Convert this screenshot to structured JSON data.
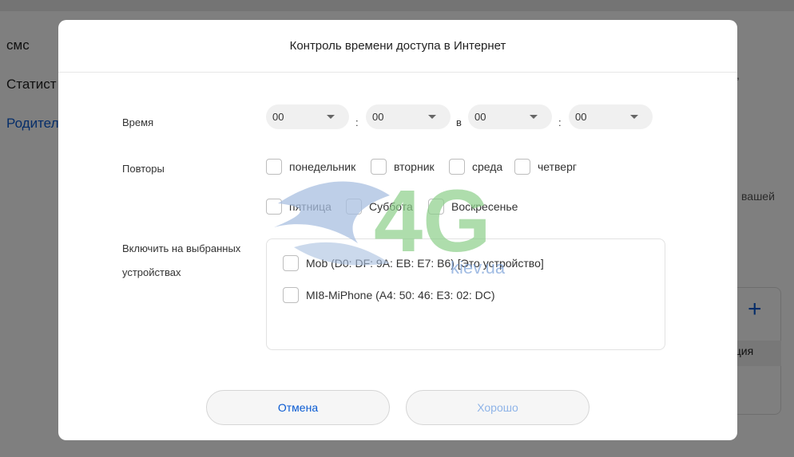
{
  "background": {
    "menu": [
      "смс",
      "Статист",
      "Родител"
    ],
    "right_texts": [
      ",",
      "вашей"
    ],
    "card_label": "ация"
  },
  "modal": {
    "title": "Контроль времени доступа в Интернет",
    "time": {
      "label": "Время",
      "start_hour": "00",
      "start_minute": "00",
      "separator": ":",
      "to_word": "в",
      "end_hour": "00",
      "end_minute": "00"
    },
    "repeat": {
      "label": "Повторы",
      "days": [
        "понедельник",
        "вторник",
        "среда",
        "четверг",
        "пятница",
        "Суббота",
        "Воскресенье"
      ]
    },
    "devices": {
      "label_line1": "Включить на выбранных",
      "label_line2": "устройствах",
      "items": [
        "Mob (D0: DF: 9A: EB: E7: B6) [Это устройство]",
        "MI8-MiPhone (A4: 50: 46: E3: 02: DC)"
      ]
    },
    "buttons": {
      "cancel": "Отмена",
      "ok": "Хорошо"
    }
  },
  "watermark": {
    "text_big": "4G",
    "text_small": "kiev.ua"
  },
  "colors": {
    "accent": "#0a5bd3",
    "ok_disabled": "#8fb4e8"
  }
}
